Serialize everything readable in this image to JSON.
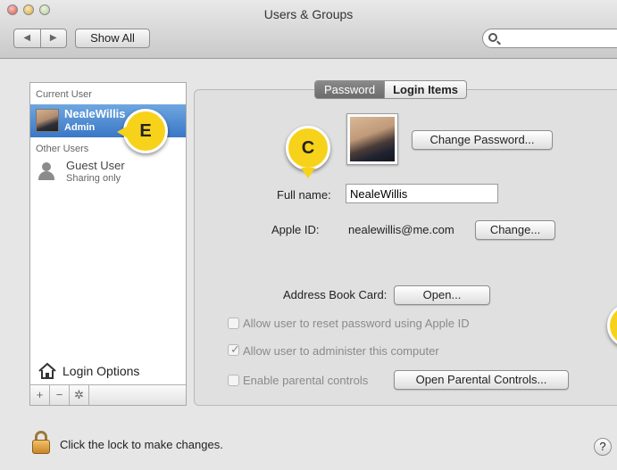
{
  "window": {
    "title": "Users & Groups"
  },
  "toolbar": {
    "nav_back": "◀",
    "nav_forward": "▶",
    "show_all_label": "Show All",
    "search_value": ""
  },
  "sidebar": {
    "current_user_header": "Current User",
    "current_user": {
      "name": "NealeWillis",
      "role": "Admin"
    },
    "other_users_header": "Other Users",
    "other_users": [
      {
        "name": "Guest User",
        "role": "Sharing only"
      }
    ],
    "login_options_label": "Login Options",
    "tools": {
      "add": "+",
      "remove": "−",
      "gear": "✲"
    }
  },
  "tabs": [
    {
      "label": "Password",
      "selected": true
    },
    {
      "label": "Login Items",
      "selected": false
    }
  ],
  "details": {
    "change_password_label": "Change Password...",
    "full_name_label": "Full name:",
    "full_name_value": "NealeWillis",
    "apple_id_label": "Apple ID:",
    "apple_id_value": "nealewillis@me.com",
    "change_label": "Change...",
    "address_book_label": "Address Book Card:",
    "open_label": "Open...",
    "checkboxes": [
      {
        "label": "Allow user to reset password using Apple ID",
        "checked": false,
        "enabled": false
      },
      {
        "label": "Allow user to administer this computer",
        "checked": true,
        "enabled": false
      },
      {
        "label": "Enable parental controls",
        "checked": false,
        "enabled": false
      }
    ],
    "open_parental_label": "Open Parental Controls..."
  },
  "footer": {
    "lock_text": "Click the lock to make changes.",
    "help_label": "?"
  },
  "callouts": {
    "e": "E",
    "c": "C"
  },
  "colors": {
    "selection": "#3a77c6",
    "callout": "#f7d21a"
  }
}
